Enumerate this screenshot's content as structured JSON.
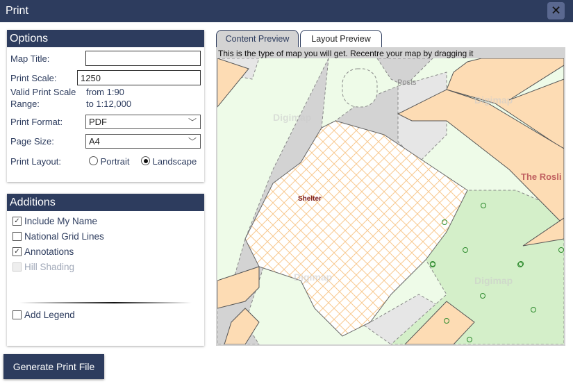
{
  "dialog": {
    "title": "Print",
    "close_icon": "close-icon"
  },
  "options": {
    "heading": "Options",
    "map_title_label": "Map Title:",
    "map_title_value": "",
    "print_scale_label": "Print Scale:",
    "print_scale_value": "1250",
    "valid_range_label_1": "Valid Print Scale",
    "valid_range_label_2": "Range:",
    "valid_range_from": "from 1:90",
    "valid_range_to": "to 1:12,000",
    "print_format_label": "Print Format:",
    "print_format_value": "PDF",
    "page_size_label": "Page Size:",
    "page_size_value": "A4",
    "print_layout_label": "Print Layout:",
    "layout_portrait": "Portrait",
    "layout_landscape": "Landscape",
    "layout_selected": "Landscape"
  },
  "additions": {
    "heading": "Additions",
    "items": [
      {
        "label": "Include My Name",
        "checked": true,
        "disabled": false
      },
      {
        "label": "National Grid Lines",
        "checked": false,
        "disabled": false
      },
      {
        "label": "Annotations",
        "checked": true,
        "disabled": false
      },
      {
        "label": "Hill Shading",
        "checked": false,
        "disabled": true
      }
    ],
    "legend": {
      "label": "Add Legend",
      "checked": false
    }
  },
  "preview": {
    "tabs": [
      {
        "label": "Content Preview",
        "active": false
      },
      {
        "label": "Layout Preview",
        "active": true
      }
    ],
    "hint": "This is the type of map you will get. Recentre your map by dragging it",
    "map_labels": {
      "posts": "Posts",
      "shelter": "Shelter",
      "building": "The Rosli",
      "watermark": "Digimap"
    }
  },
  "generate_button": "Generate Print File",
  "colors": {
    "brand": "#2d3c5e",
    "building": "#fddcb4",
    "green": "#eefbe8",
    "park": "#d4efc9",
    "road": "#d3d3d3",
    "hatch": "#f8c98f"
  }
}
